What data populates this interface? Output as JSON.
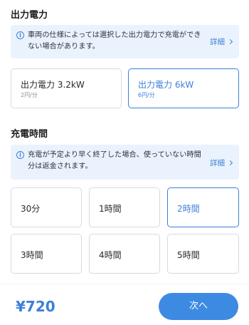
{
  "output_section": {
    "title": "出力電力",
    "info_text": "車両の仕様によっては選択した出力電力で充電ができない場合があります。",
    "info_link": "詳細",
    "options": [
      {
        "label": "出力電力 3.2kW",
        "sub": "2円/分",
        "selected": false
      },
      {
        "label": "出力電力 6kW",
        "sub": "6円/分",
        "selected": true
      }
    ]
  },
  "time_section": {
    "title": "充電時間",
    "info_text": "充電が予定より早く終了した場合、使っていない時間分は返金されます。",
    "info_link": "詳細",
    "options": [
      {
        "label": "30分",
        "selected": false
      },
      {
        "label": "1時間",
        "selected": false
      },
      {
        "label": "2時間",
        "selected": true
      },
      {
        "label": "3時間",
        "selected": false
      },
      {
        "label": "4時間",
        "selected": false
      },
      {
        "label": "5時間",
        "selected": false
      }
    ]
  },
  "footer": {
    "price": "¥720",
    "next_label": "次へ"
  },
  "colors": {
    "accent": "#3d7fd9",
    "info_bg": "#eaf3fd",
    "button_bg": "#3d8ae3"
  }
}
